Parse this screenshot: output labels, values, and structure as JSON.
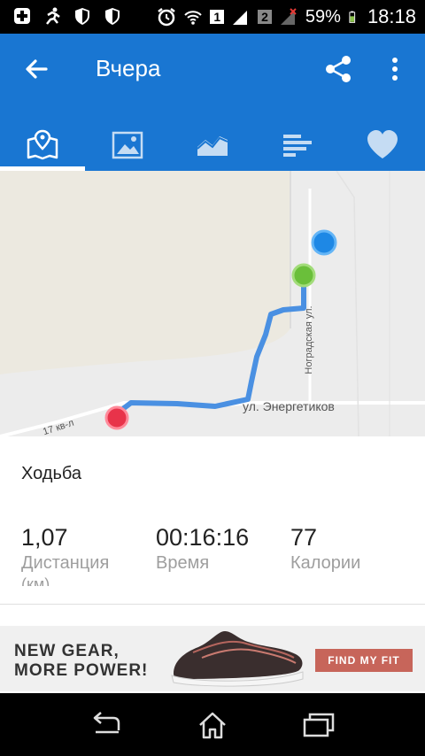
{
  "status_bar": {
    "battery": "59%",
    "time": "18:18",
    "sim1": "1",
    "sim2": "2",
    "icons": [
      "plus-icon",
      "runner-icon",
      "shield-icon",
      "shield-icon",
      "alarm-icon",
      "wifi-icon",
      "signal-icon",
      "signal-icon",
      "battery-icon"
    ]
  },
  "app_bar": {
    "title": "Вчера",
    "back_icon": "arrow-back-icon",
    "share_icon": "share-icon",
    "more_icon": "more-vert-icon"
  },
  "tabs": [
    {
      "name": "map",
      "icon": "map-icon",
      "selected": true
    },
    {
      "name": "photos",
      "icon": "image-icon",
      "selected": false
    },
    {
      "name": "chart",
      "icon": "area-chart-icon",
      "selected": false
    },
    {
      "name": "laps",
      "icon": "bars-icon",
      "selected": false
    },
    {
      "name": "health",
      "icon": "heart-icon",
      "selected": false
    }
  ],
  "map": {
    "labels": {
      "street1": "ул. Энергетиков",
      "street2": "Ноградская ул.",
      "street3": "17 кв-л"
    },
    "colors": {
      "route": "#4a90e2",
      "start": "#e8334a",
      "end": "#6abf3a",
      "current": "#1e88e5"
    }
  },
  "activity": {
    "type": "Ходьба"
  },
  "stats": [
    {
      "value": "1,07",
      "label": "Дистанция",
      "unit": "(км)"
    },
    {
      "value": "00:16:16",
      "label": "Время"
    },
    {
      "value": "77",
      "label": "Калории"
    }
  ],
  "ad": {
    "line1": "NEW GEAR,",
    "line2": "MORE POWER!",
    "button": "FIND MY FIT",
    "image": "sneaker-image"
  },
  "nav": {
    "back": "back-icon",
    "home": "home-icon",
    "recents": "recents-icon"
  }
}
